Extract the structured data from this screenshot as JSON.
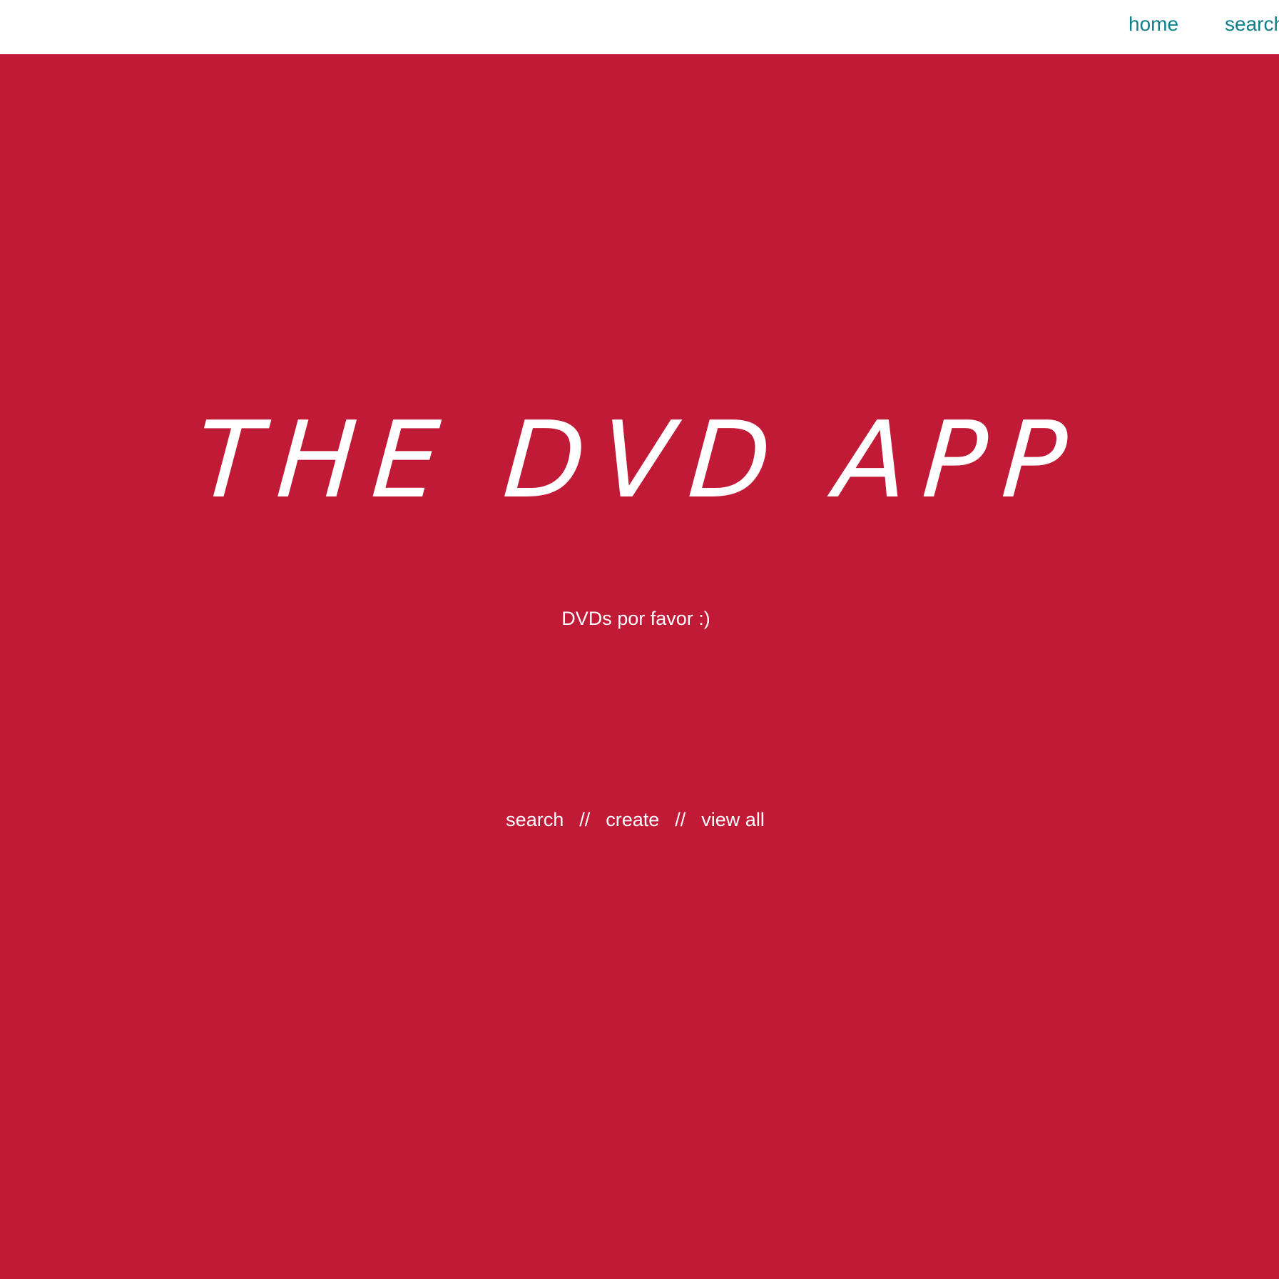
{
  "nav": {
    "home_label": "home",
    "search_label": "search"
  },
  "hero": {
    "title": "THE DVD APP",
    "subtitle": "DVDs por favor :)",
    "actions": {
      "search_label": "search",
      "separator": "//",
      "create_label": "create",
      "view_all_label": "view all"
    }
  },
  "colors": {
    "background": "#c01a37",
    "topbar": "#ffffff",
    "nav_link": "#0f8089",
    "hero_text": "#ffffff"
  }
}
